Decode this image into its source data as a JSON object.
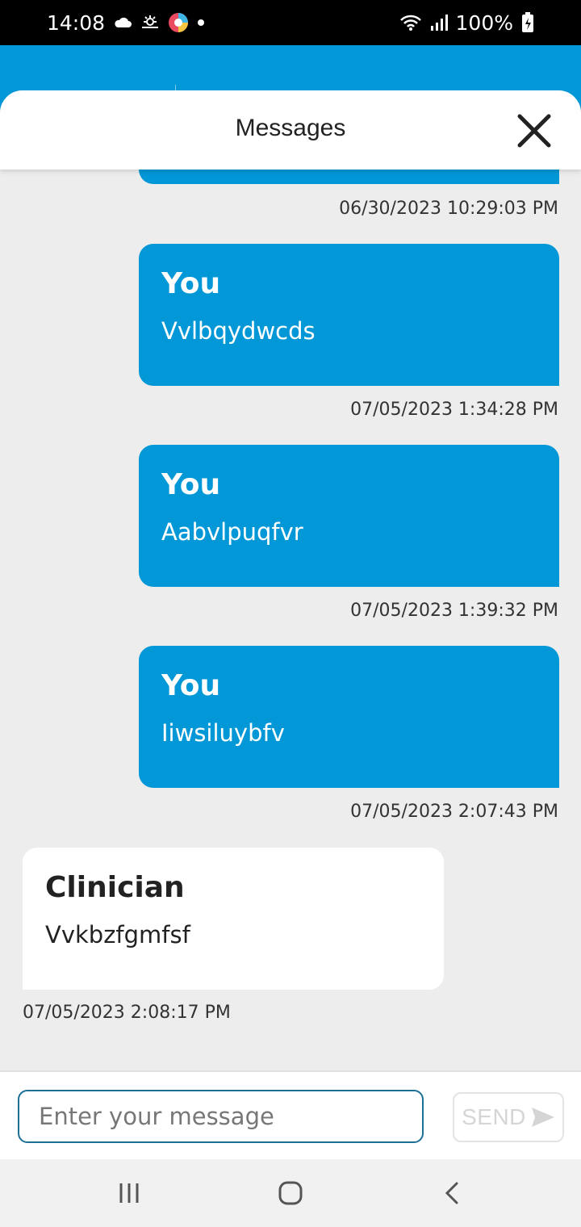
{
  "status_bar": {
    "time": "14:08",
    "battery": "100%",
    "icons": [
      "cloud-icon",
      "weather-icon",
      "app-icon",
      "dot-icon",
      "wifi-icon",
      "signal-icon",
      "battery-icon"
    ]
  },
  "header": {
    "title": "Messages",
    "close_icon": "close-icon"
  },
  "messages": [
    {
      "direction": "out",
      "sender": "",
      "text": "",
      "timestamp": "06/30/2023 10:29:03 PM"
    },
    {
      "direction": "out",
      "sender": "You",
      "text": "Vvlbqydwcds",
      "timestamp": "07/05/2023 1:34:28 PM"
    },
    {
      "direction": "out",
      "sender": "You",
      "text": "Aabvlpuqfvr",
      "timestamp": "07/05/2023 1:39:32 PM"
    },
    {
      "direction": "out",
      "sender": "You",
      "text": "Iiwsiluybfv",
      "timestamp": "07/05/2023 2:07:43 PM"
    },
    {
      "direction": "in",
      "sender": "Clinician",
      "text": "Vvkbzfgmfsf",
      "timestamp": "07/05/2023 2:08:17 PM"
    }
  ],
  "composer": {
    "placeholder": "Enter your message",
    "value": "",
    "send_label": "SEND"
  },
  "colors": {
    "accent": "#0297d6",
    "background": "#ededed",
    "incoming_bubble": "#ffffff"
  }
}
